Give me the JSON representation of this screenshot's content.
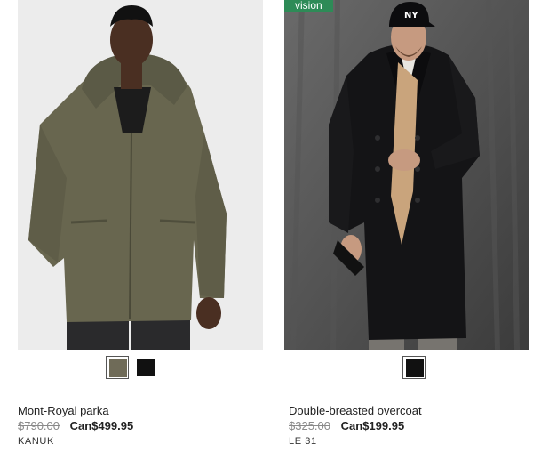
{
  "products": [
    {
      "name": "Mont-Royal parka",
      "old_price": "$790.00",
      "sale_price": "Can$499.95",
      "brand": "KANUK",
      "swatches": [
        {
          "color": "#6f6b58",
          "selected": true
        },
        {
          "color": "#111111",
          "selected": false
        }
      ]
    },
    {
      "badge": "vision",
      "name": "Double-breasted overcoat",
      "old_price": "$325.00",
      "sale_price": "Can$199.95",
      "brand": "LE 31",
      "swatches": [
        {
          "color": "#111111",
          "selected": true
        }
      ]
    }
  ],
  "colors": {
    "badge_green": "#2e8b57",
    "strike_grey": "#8a8a8a",
    "text": "#222222"
  }
}
